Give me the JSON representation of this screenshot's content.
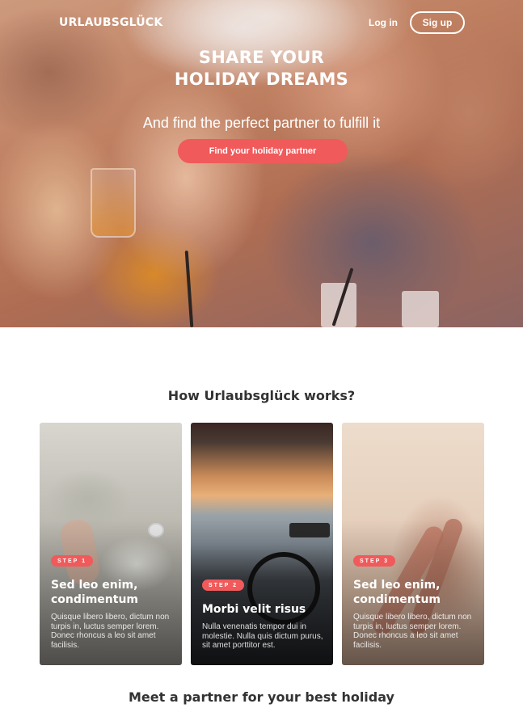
{
  "header": {
    "logo": "URLAUBSGLÜCK",
    "login_label": "Log in",
    "signup_label": "Sig up"
  },
  "hero": {
    "title_line1": "SHARE YOUR",
    "title_line2": "HOLIDAY DREAMS",
    "subtitle": "And find the perfect partner to fulfill it",
    "cta_label": "Find your holiday partner"
  },
  "how_it_works": {
    "title": "How Urlaubsglück works?",
    "cards": [
      {
        "step": "STEP 1",
        "title": "Sed leo enim, condimentum",
        "text": "Quisque libero libero, dictum non turpis in, luctus semper lorem. Donec rhoncus a leo sit amet facilisis."
      },
      {
        "step": "STEP 2",
        "title": "Morbi velit risus",
        "text": "Nulla venenatis tempor dui in molestie. Nulla quis dictum purus, sit amet porttitor est."
      },
      {
        "step": "STEP 3",
        "title": "Sed leo enim, condimentum",
        "text": "Quisque libero libero, dictum non turpis in, luctus semper lorem. Donec rhoncus a leo sit amet facilisis."
      }
    ]
  },
  "partner_section": {
    "title": "Meet a partner for your best holiday"
  },
  "colors": {
    "accent": "#f05a5b",
    "text_dark": "#333333"
  }
}
